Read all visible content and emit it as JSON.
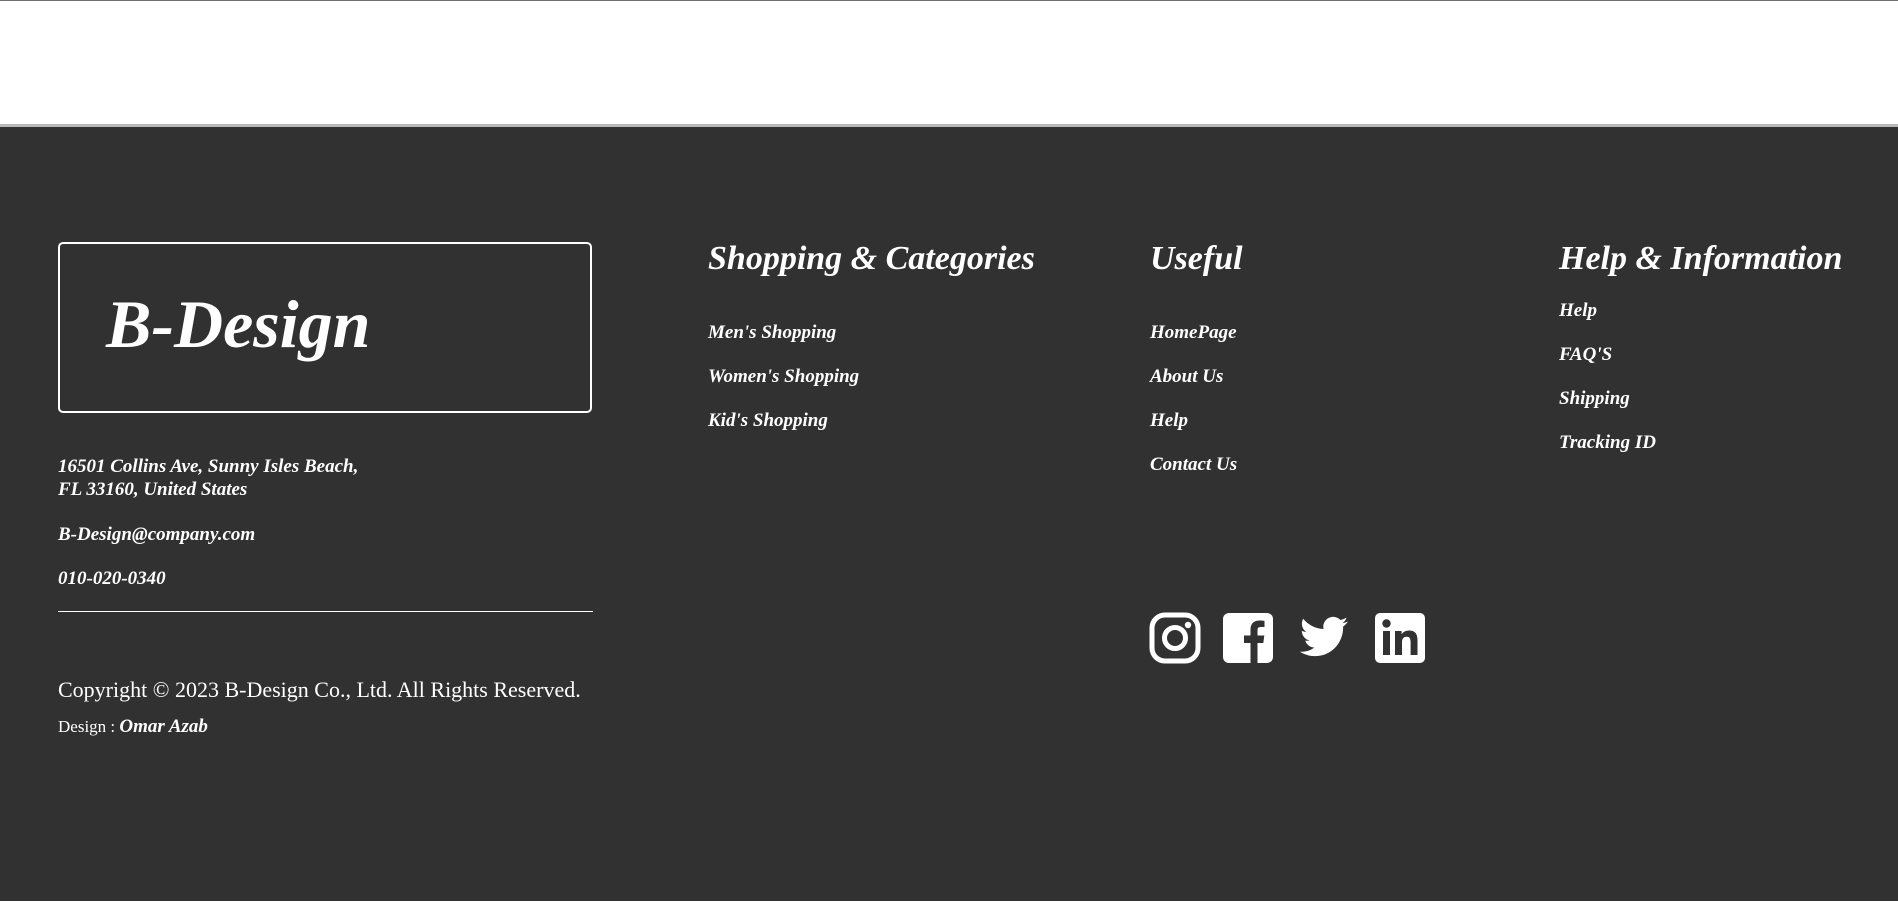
{
  "brand": {
    "name": "B-Design"
  },
  "contact": {
    "address_line1": "16501 Collins Ave, Sunny Isles Beach,",
    "address_line2": "FL 33160, United States",
    "email": "B-Design@company.com",
    "phone": "010-020-0340"
  },
  "copyright": {
    "text": "Copyright © 2023 B-Design Co., Ltd. All Rights Reserved.",
    "design_label": "Design : ",
    "designer": "Omar Azab"
  },
  "columns": {
    "shopping": {
      "heading": "Shopping & Categories",
      "links": [
        "Men's Shopping",
        "Women's Shopping",
        "Kid's Shopping"
      ]
    },
    "useful": {
      "heading": "Useful",
      "links": [
        "HomePage",
        "About Us",
        "Help",
        "Contact Us"
      ]
    },
    "help": {
      "heading": "Help & Information",
      "links": [
        "Help",
        "FAQ'S",
        "Shipping",
        "Tracking ID"
      ]
    }
  },
  "social": {
    "icons": [
      "instagram-icon",
      "facebook-icon",
      "twitter-icon",
      "linkedin-icon"
    ]
  },
  "colors": {
    "footer_background": "#313131",
    "text": "#ffffff",
    "page_background": "#ffffff"
  }
}
